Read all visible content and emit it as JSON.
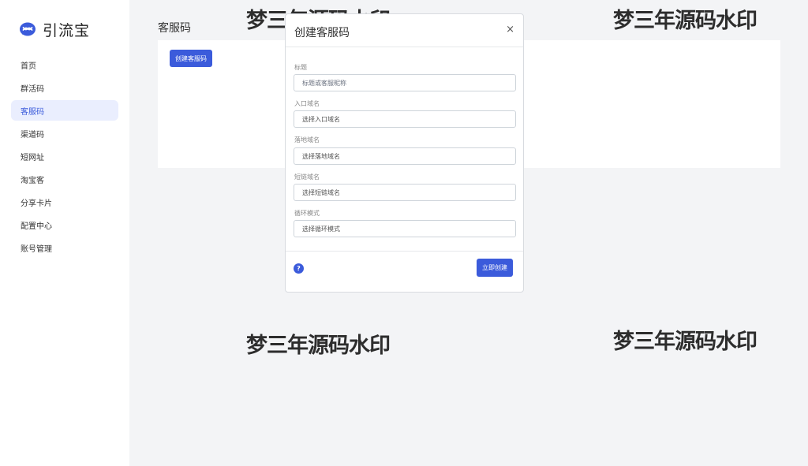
{
  "brand": {
    "name": "引流宝",
    "icon": "chat-bubbles-icon",
    "color": "#3b5bdb"
  },
  "sidebar": {
    "items": [
      {
        "label": "首页",
        "active": false
      },
      {
        "label": "群活码",
        "active": false
      },
      {
        "label": "客服码",
        "active": true
      },
      {
        "label": "渠道码",
        "active": false
      },
      {
        "label": "短网址",
        "active": false
      },
      {
        "label": "淘宝客",
        "active": false
      },
      {
        "label": "分享卡片",
        "active": false
      },
      {
        "label": "配置中心",
        "active": false
      },
      {
        "label": "账号管理",
        "active": false
      }
    ]
  },
  "main": {
    "title": "客服码",
    "create_button": "创建客服码"
  },
  "modal": {
    "title": "创建客服码",
    "close": "×",
    "fields": [
      {
        "label": "标题",
        "placeholder": "标题或客服昵称"
      },
      {
        "label": "入口域名",
        "value": "选择入口域名"
      },
      {
        "label": "落地域名",
        "value": "选择落地域名"
      },
      {
        "label": "短链域名",
        "value": "选择短链域名"
      },
      {
        "label": "循环模式",
        "value": "选择循环模式"
      }
    ],
    "help": "?",
    "submit": "立即创建"
  },
  "watermarks": [
    "梦三年源码水印",
    "梦三年源码水印",
    "梦三年源码水印",
    "梦三年源码水印"
  ],
  "colors": {
    "accent": "#3b5bdb",
    "active_bg": "#eaeefe",
    "page_bg": "#f3f4f6"
  }
}
